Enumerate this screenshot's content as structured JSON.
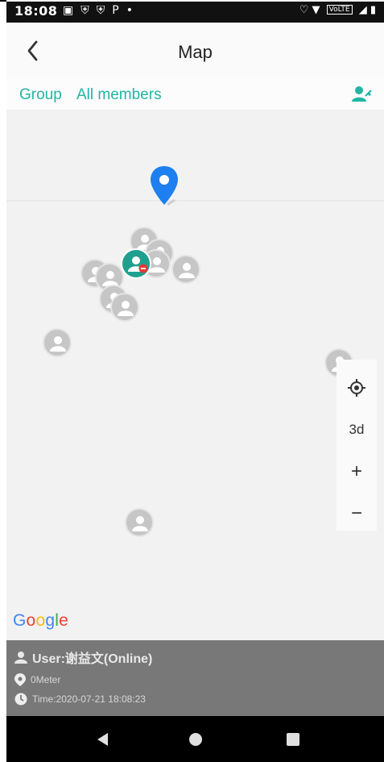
{
  "status_bar": {
    "time": "18:08",
    "left_icons": [
      "notification-icon",
      "shield-icon",
      "shield-icon",
      "parking-icon",
      "dot-icon"
    ],
    "volte_label": "VoLTE",
    "right_icons": [
      "location-icon",
      "wifi-icon",
      "signal-icon",
      "battery-icon"
    ]
  },
  "app_bar": {
    "title": "Map",
    "back_icon": "chevron-left-icon"
  },
  "group_bar": {
    "label": "Group",
    "value": "All members",
    "action_icon": "member-select-icon"
  },
  "map": {
    "attribution": [
      "G",
      "o",
      "o",
      "g",
      "l",
      "e"
    ],
    "attribution_colors": [
      "#4285F4",
      "#EA4335",
      "#FBBC05",
      "#4285F4",
      "#34A853",
      "#EA4335"
    ],
    "controls": {
      "locate_icon": "my-location-icon",
      "mode_3d": "3d",
      "zoom_in": "+",
      "zoom_out": "−"
    },
    "marker_color": "#c6c6c6",
    "active_marker_color": "#1fa08f",
    "pin_color": "#1e7ff0"
  },
  "info_panel": {
    "user": "User:谢益文(Online)",
    "distance": "0Meter",
    "time": "Time:2020-07-21 18:08:23"
  },
  "nav_bar": {
    "back_icon": "triangle-back-icon",
    "home_icon": "circle-home-icon",
    "recents_icon": "square-recents-icon"
  }
}
